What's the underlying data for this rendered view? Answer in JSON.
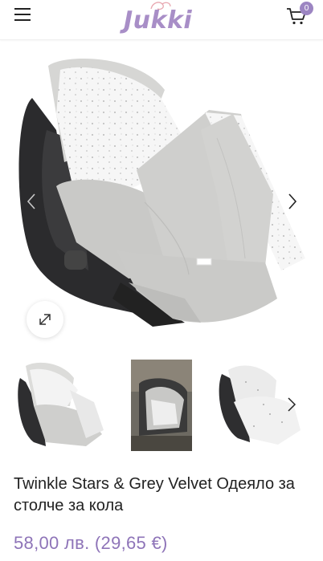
{
  "header": {
    "logo_text": "Jukki",
    "cart_count": "0",
    "brand_color": "#a88ec7",
    "accent_color": "#9c85c2"
  },
  "icons": {
    "menu": "hamburger-menu-icon",
    "cart": "shopping-cart-icon",
    "zoom": "expand-icon",
    "prev": "chevron-left-icon",
    "next": "chevron-right-icon"
  },
  "product": {
    "title": "Twinkle Stars & Grey Velvet Одеяло за столче за кола",
    "price": "58,00 лв. (29,65 €)",
    "price_color": "#8e74b8"
  },
  "gallery": {
    "thumbnails": [
      "thumbnail-1",
      "thumbnail-2",
      "thumbnail-3"
    ]
  }
}
